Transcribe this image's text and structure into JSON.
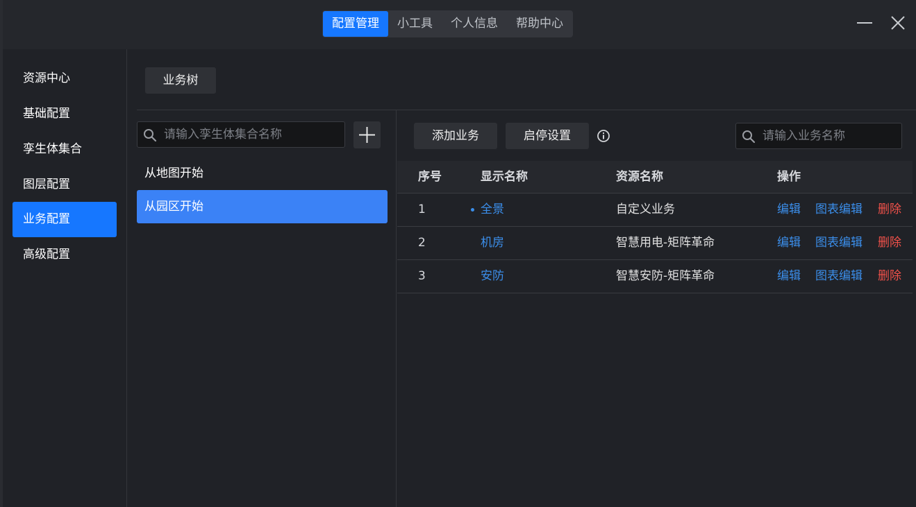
{
  "top_tabs": [
    "配置管理",
    "小工具",
    "个人信息",
    "帮助中心"
  ],
  "sidebar": {
    "items": [
      "资源中心",
      "基础配置",
      "孪生体集合",
      "图层配置",
      "业务配置",
      "高级配置"
    ],
    "active_index": 4
  },
  "tree": {
    "tab_label": "业务树",
    "search_placeholder": "请输入孪生体集合名称",
    "items": [
      "从地图开始",
      "从园区开始"
    ],
    "active_index": 1
  },
  "toolbar": {
    "add_label": "添加业务",
    "toggle_label": "启停设置",
    "search_placeholder": "请输入业务名称"
  },
  "table": {
    "headers": [
      "序号",
      "显示名称",
      "资源名称",
      "操作"
    ],
    "rows": [
      {
        "index": "1",
        "name": "全景",
        "resource": "自定义业务",
        "current": true
      },
      {
        "index": "2",
        "name": "机房",
        "resource": "智慧用电-矩阵革命",
        "current": false
      },
      {
        "index": "3",
        "name": "安防",
        "resource": "智慧安防-矩阵革命",
        "current": false
      }
    ],
    "actions": {
      "edit": "编辑",
      "chart_edit": "图表编辑",
      "delete": "删除"
    }
  },
  "colors": {
    "accent": "#1677ff",
    "link": "#3b8eea",
    "danger": "#f0514a",
    "background": "#202227"
  },
  "icons": [
    "search-icon",
    "plus-icon",
    "info-icon",
    "minimize-icon",
    "close-icon"
  ]
}
